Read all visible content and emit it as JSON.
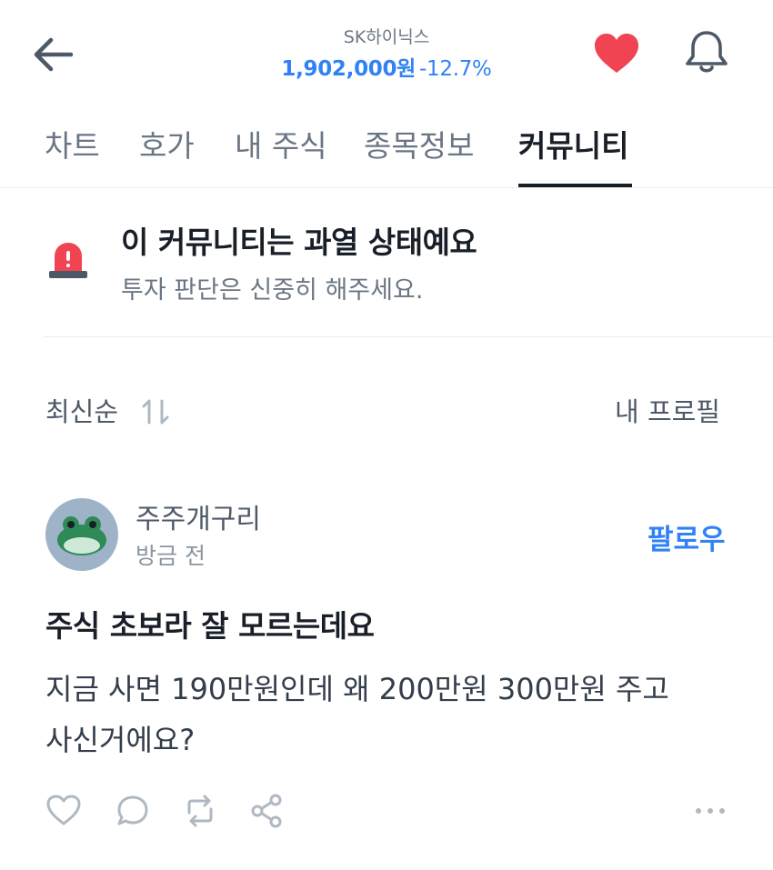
{
  "header": {
    "stock_name": "SK하이닉스",
    "price": "1,902,000원",
    "change": "-12.7%",
    "icons": [
      "back-arrow-icon",
      "heart-icon",
      "bell-icon"
    ],
    "accent_color": "#3182f6",
    "heart_color": "#f04452"
  },
  "tabs": [
    {
      "label": "차트",
      "active": false
    },
    {
      "label": "호가",
      "active": false
    },
    {
      "label": "내 주식",
      "active": false
    },
    {
      "label": "종목정보",
      "active": false
    },
    {
      "label": "커뮤니티",
      "active": true
    }
  ],
  "alert": {
    "icon": "siren-icon",
    "title": "이 커뮤니티는 과열 상태예요",
    "subtitle": "투자 판단은 신중히 해주세요."
  },
  "sort": {
    "label": "최신순",
    "icon": "sort-arrows-icon",
    "profile_link": "내 프로필"
  },
  "post": {
    "author": "주주개구리",
    "avatar_icon": "frog-avatar-icon",
    "time": "방금 전",
    "follow_label": "팔로우",
    "title": "주식 초보라 잘 모르는데요",
    "body_line1": "지금 사면 190만원인데 왜 200만원 300만원 주고",
    "body_line2": "사신거에요?",
    "actions": [
      "like-icon",
      "comment-icon",
      "repost-icon",
      "share-icon",
      "more-icon"
    ]
  }
}
